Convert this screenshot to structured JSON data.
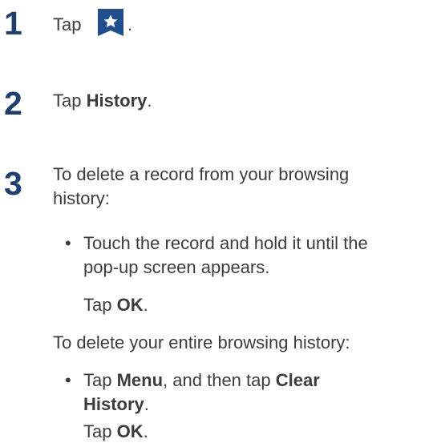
{
  "steps": [
    {
      "number": "1",
      "text_before": "Tap",
      "icon": "bookmark-star-icon",
      "text_after": "."
    },
    {
      "number": "2",
      "prefix": "Tap ",
      "bold": "History",
      "suffix": "."
    },
    {
      "number": "3",
      "intro_line1": "To delete a record from your browsing",
      "intro_line2": "history:",
      "bullet1_line1": "Touch the record and hold it until the",
      "bullet1_line2": "pop-up screen appears.",
      "tap_ok1_prefix": "Tap ",
      "tap_ok1_bold": "OK",
      "tap_ok1_suffix": ".",
      "intro2": "To delete your entire browsing history:",
      "bullet2_prefix": "Tap ",
      "bullet2_bold1": "Menu",
      "bullet2_middle": ", and then tap ",
      "bullet2_bold2_line1": "Clear",
      "bullet2_bold2_line2": "History",
      "bullet2_suffix": ".",
      "tap_ok2_prefix": "Tap ",
      "tap_ok2_bold": "OK",
      "tap_ok2_suffix": "."
    }
  ],
  "bullet_char": "•",
  "colors": {
    "step_number": "#1f3f73",
    "icon_bg": "#1f4f8f",
    "text": "#3c3c3c"
  }
}
